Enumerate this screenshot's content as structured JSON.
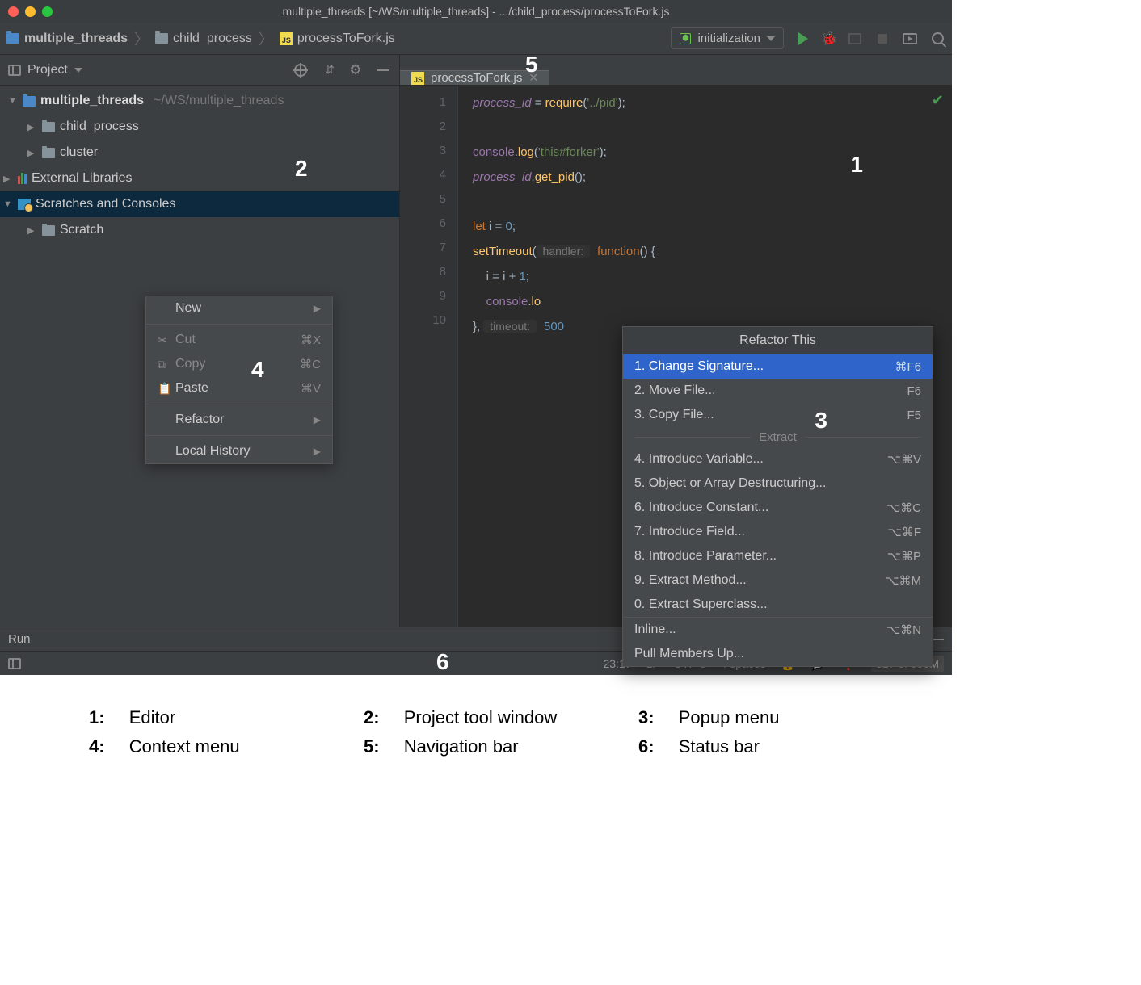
{
  "titlebar": {
    "title": "multiple_threads [~/WS/multiple_threads] - .../child_process/processToFork.js"
  },
  "navbar": {
    "breadcrumb": [
      {
        "label": "multiple_threads",
        "icon": "folder-blue"
      },
      {
        "label": "child_process",
        "icon": "folder"
      },
      {
        "label": "processToFork.js",
        "icon": "js"
      }
    ],
    "run_config": "initialization"
  },
  "sidebar": {
    "title": "Project",
    "tree": {
      "root": {
        "label": "multiple_threads",
        "path": "~/WS/multiple_threads"
      },
      "children": [
        {
          "label": "child_process"
        },
        {
          "label": "cluster"
        }
      ],
      "external": "External Libraries",
      "scratches": "Scratches and Consoles",
      "scratch_child": "Scratch"
    }
  },
  "context_menu": {
    "items": {
      "new": "New",
      "cut": "Cut",
      "cut_sc": "⌘X",
      "copy": "Copy",
      "copy_sc": "⌘C",
      "paste": "Paste",
      "paste_sc": "⌘V",
      "refactor": "Refactor",
      "history": "Local History"
    }
  },
  "editor": {
    "tab": "processToFork.js",
    "line_numbers": [
      "1",
      "2",
      "3",
      "4",
      "5",
      "6",
      "7",
      "8",
      "9",
      "10"
    ],
    "code": {
      "l1_a": "process_id",
      "l1_b": " = ",
      "l1_c": "require",
      "l1_d": "(",
      "l1_e": "'../pid'",
      "l1_f": ");",
      "l3_a": "console",
      "l3_b": ".",
      "l3_c": "log",
      "l3_d": "(",
      "l3_e": "'this#forker'",
      "l3_f": ");",
      "l4_a": "process_id",
      "l4_b": ".",
      "l4_c": "get_pid",
      "l4_d": "();",
      "l6_a": "let ",
      "l6_b": "i",
      "l6_c": " = ",
      "l6_d": "0",
      "l6_e": ";",
      "l7_a": "setTimeout",
      "l7_b": "(",
      "l7_h": " handler: ",
      "l7_c": "function",
      "l7_d": "() {",
      "l8_a": "    i = i + ",
      "l8_b": "1",
      "l8_c": ";",
      "l9_a": "    ",
      "l9_b": "console",
      "l9_c": ".",
      "l9_d": "lo",
      "l10_a": "}, ",
      "l10_h": " timeout: ",
      "l10_b": "500"
    }
  },
  "popup": {
    "title": "Refactor This",
    "items": [
      {
        "label": "1. Change Signature...",
        "sc": "⌘F6",
        "hl": true
      },
      {
        "label": "2. Move File...",
        "sc": "F6"
      },
      {
        "label": "3. Copy File...",
        "sc": "F5"
      }
    ],
    "extract_header": "Extract",
    "extract": [
      {
        "label": "4. Introduce Variable...",
        "sc": "⌥⌘V"
      },
      {
        "label": "5. Object or Array Destructuring..."
      },
      {
        "label": "6. Introduce Constant...",
        "sc": "⌥⌘C"
      },
      {
        "label": "7. Introduce Field...",
        "sc": "⌥⌘F"
      },
      {
        "label": "8. Introduce Parameter...",
        "sc": "⌥⌘P"
      },
      {
        "label": "9. Extract Method...",
        "sc": "⌥⌘M"
      },
      {
        "label": "0. Extract Superclass..."
      }
    ],
    "tail": [
      {
        "label": "Inline...",
        "sc": "⌥⌘N"
      },
      {
        "label": "Pull Members Up..."
      }
    ]
  },
  "bottom": {
    "run": "Run"
  },
  "status": {
    "pos": "23:17",
    "eol": "LF",
    "enc": "UTF-8",
    "indent": "4 spaces",
    "mem": "327 of 990M"
  },
  "markers": {
    "m1": "1",
    "m2": "2",
    "m3": "3",
    "m4": "4",
    "m5": "5",
    "m6": "6"
  },
  "legend": {
    "l1": "Editor",
    "l2": "Project tool window",
    "l3": "Popup menu",
    "l4": "Context menu",
    "l5": "Navigation bar",
    "l6": "Status bar"
  }
}
